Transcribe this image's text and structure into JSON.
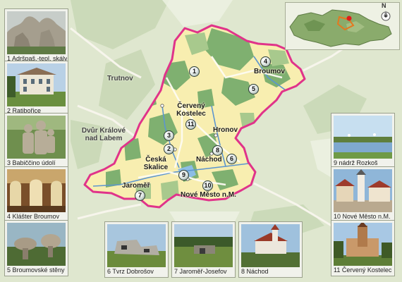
{
  "towns": {
    "trutnov": "Trutnov",
    "broumov": "Broumov",
    "cerveny_kostelec": [
      "Červený",
      "Kostelec"
    ],
    "hronov": "Hronov",
    "dvur_kralove": [
      "Dvůr Králové",
      "nad Labem"
    ],
    "ceska_skalice": [
      "Česká",
      "Skalice"
    ],
    "nachod": "Náchod",
    "jaromer": "Jaroměř",
    "nove_mesto": "Nové Město n.M."
  },
  "markers": [
    "1",
    "2",
    "3",
    "4",
    "5",
    "6",
    "7",
    "8",
    "9",
    "10",
    "11"
  ],
  "thumbnails": {
    "t1": "1 Adršpaš.-tepl. skály",
    "t2": "2 Ratibořice",
    "t3": "3 Babiččino údolí",
    "t4": "4 Klášter Broumov",
    "t5": "5 Broumovské stěny",
    "t6": "6 Tvrz Dobrošov",
    "t7": "7 Jaroměř-Josefov",
    "t8": "8 Náchod",
    "t9": "9 nádrž Rozkoš",
    "t10": "10 Nové Město n.M.",
    "t11": "11 Červený Kostelec"
  },
  "compass": {
    "north_label": "N"
  },
  "colors": {
    "region_border": "#e0338a",
    "region_fill": "#f8eeb0",
    "forest": "#7fb070",
    "river": "#5c95cf",
    "road": "#f2efe6",
    "background_land": "#dfe7cf"
  },
  "icons": {
    "compass": "compass-icon",
    "marker": "numbered-map-marker"
  }
}
